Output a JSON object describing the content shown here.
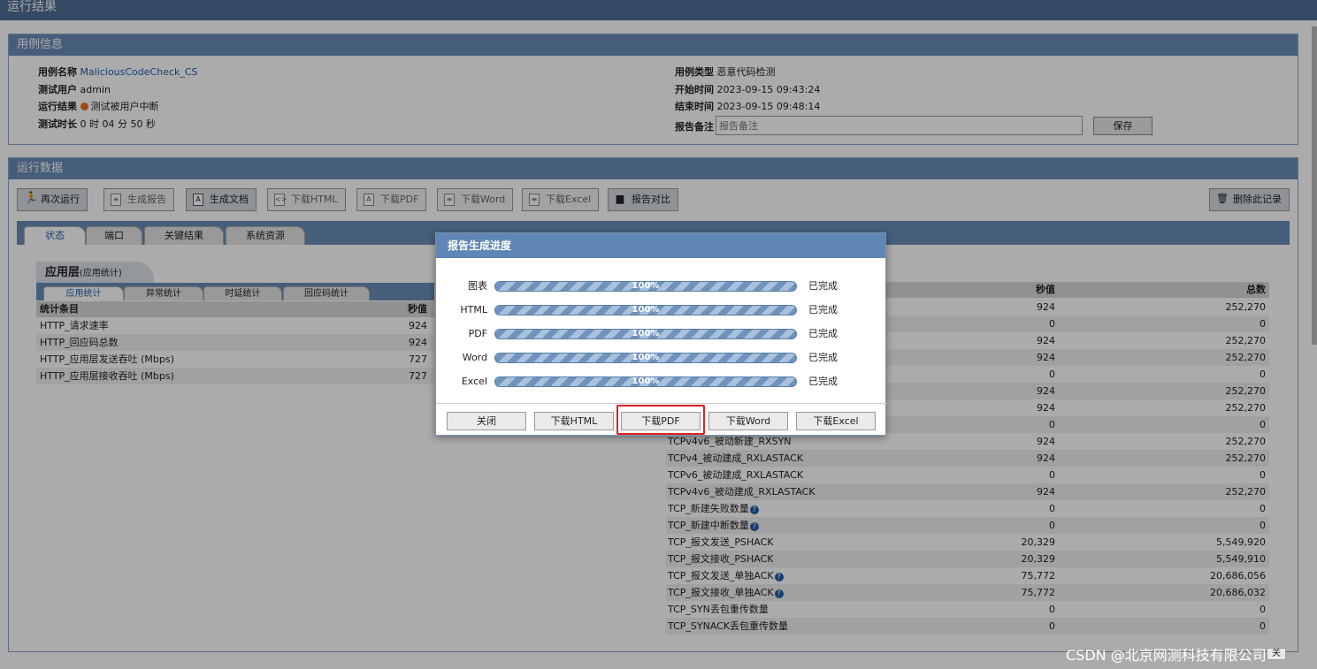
{
  "window_title": "运行结果",
  "case_info": {
    "title": "用例信息",
    "name_label": "用例名称",
    "name_value": "MaliciousCodeCheck_CS",
    "user_label": "测试用户",
    "user_value": "admin",
    "result_label": "运行结果",
    "result_value": "测试被用户中断",
    "duration_label": "测试时长",
    "duration_value": "0 时 04 分 50 秒",
    "type_label": "用例类型",
    "type_value": "恶意代码检测",
    "start_label": "开始时间",
    "start_value": "2023-09-15 09:43:24",
    "end_label": "结束时间",
    "end_value": "2023-09-15 09:48:14",
    "remark_label": "报告备注",
    "remark_placeholder": "报告备注",
    "save_label": "保存",
    "status_color": "#e8701a"
  },
  "run_data": {
    "title": "运行数据",
    "toolbar": {
      "rerun": "再次运行",
      "gen_report": "生成报告",
      "gen_doc": "生成文档",
      "dl_html": "下载HTML",
      "dl_pdf": "下载PDF",
      "dl_word": "下载Word",
      "dl_excel": "下载Excel",
      "compare": "报告对比",
      "delete": "删除此记录"
    },
    "tabs": [
      "状态",
      "端口",
      "关键结果",
      "系统资源"
    ],
    "section_title": "应用层",
    "section_sub": "(应用统计)",
    "sub_tabs": [
      "应用统计",
      "异常统计",
      "时延统计",
      "回应码统计"
    ],
    "left_table": {
      "headers": [
        "统计条目",
        "秒值"
      ],
      "rows": [
        [
          "HTTP_请求速率",
          "924"
        ],
        [
          "HTTP_回应码总数",
          "924"
        ],
        [
          "HTTP_应用层发送吞吐 (Mbps)",
          "727"
        ],
        [
          "HTTP_应用层接收吞吐 (Mbps)",
          "727"
        ]
      ]
    },
    "right_table": {
      "headers": [
        "秒值",
        "总数"
      ],
      "rows": [
        {
          "name": "",
          "sec": "924",
          "total": "252,270",
          "help": false
        },
        {
          "name": "",
          "sec": "0",
          "total": "0",
          "help": false
        },
        {
          "name": "",
          "sec": "924",
          "total": "252,270",
          "help": false
        },
        {
          "name": "",
          "sec": "924",
          "total": "252,270",
          "help": false
        },
        {
          "name": "",
          "sec": "0",
          "total": "0",
          "help": false
        },
        {
          "name": "",
          "sec": "924",
          "total": "252,270",
          "help": false
        },
        {
          "name": "",
          "sec": "924",
          "total": "252,270",
          "help": false
        },
        {
          "name": "",
          "sec": "0",
          "total": "0",
          "help": false
        },
        {
          "name": "TCPv4v6_被动新建_RXSYN",
          "sec": "924",
          "total": "252,270",
          "help": false
        },
        {
          "name": "TCPv4_被动建成_RXLASTACK",
          "sec": "924",
          "total": "252,270",
          "help": false
        },
        {
          "name": "TCPv6_被动建成_RXLASTACK",
          "sec": "0",
          "total": "0",
          "help": false
        },
        {
          "name": "TCPv4v6_被动建成_RXLASTACK",
          "sec": "924",
          "total": "252,270",
          "help": false
        },
        {
          "name": "TCP_新建失败数量",
          "sec": "0",
          "total": "0",
          "help": true
        },
        {
          "name": "TCP_新建中断数量",
          "sec": "0",
          "total": "0",
          "help": true
        },
        {
          "name": "TCP_报文发送_PSHACK",
          "sec": "20,329",
          "total": "5,549,920",
          "help": false
        },
        {
          "name": "TCP_报文接收_PSHACK",
          "sec": "20,329",
          "total": "5,549,910",
          "help": false
        },
        {
          "name": "TCP_报文发送_单独ACK",
          "sec": "75,772",
          "total": "20,686,056",
          "help": true
        },
        {
          "name": "TCP_报文接收_单独ACK",
          "sec": "75,772",
          "total": "20,686,032",
          "help": true
        },
        {
          "name": "TCP_SYN丢包重传数量",
          "sec": "0",
          "total": "0",
          "help": false
        },
        {
          "name": "TCP_SYNACK丢包重传数量",
          "sec": "0",
          "total": "0",
          "help": false
        }
      ]
    }
  },
  "modal": {
    "title": "报告生成进度",
    "rows": [
      {
        "label": "图表",
        "percent": "100%",
        "progress": 1.0,
        "status": "已完成"
      },
      {
        "label": "HTML",
        "percent": "100%",
        "progress": 1.0,
        "status": "已完成"
      },
      {
        "label": "PDF",
        "percent": "100%",
        "progress": 1.0,
        "status": "已完成"
      },
      {
        "label": "Word",
        "percent": "100%",
        "progress": 1.0,
        "status": "已完成"
      },
      {
        "label": "Excel",
        "percent": "100%",
        "progress": 1.0,
        "status": "已完成"
      }
    ],
    "buttons": {
      "close": "关闭",
      "html": "下载HTML",
      "pdf": "下载PDF",
      "word": "下载Word",
      "excel": "下载Excel"
    },
    "highlight_color": "#e02020"
  },
  "watermark": "CSDN @北京网测科技有限公司",
  "corner_button": "关"
}
